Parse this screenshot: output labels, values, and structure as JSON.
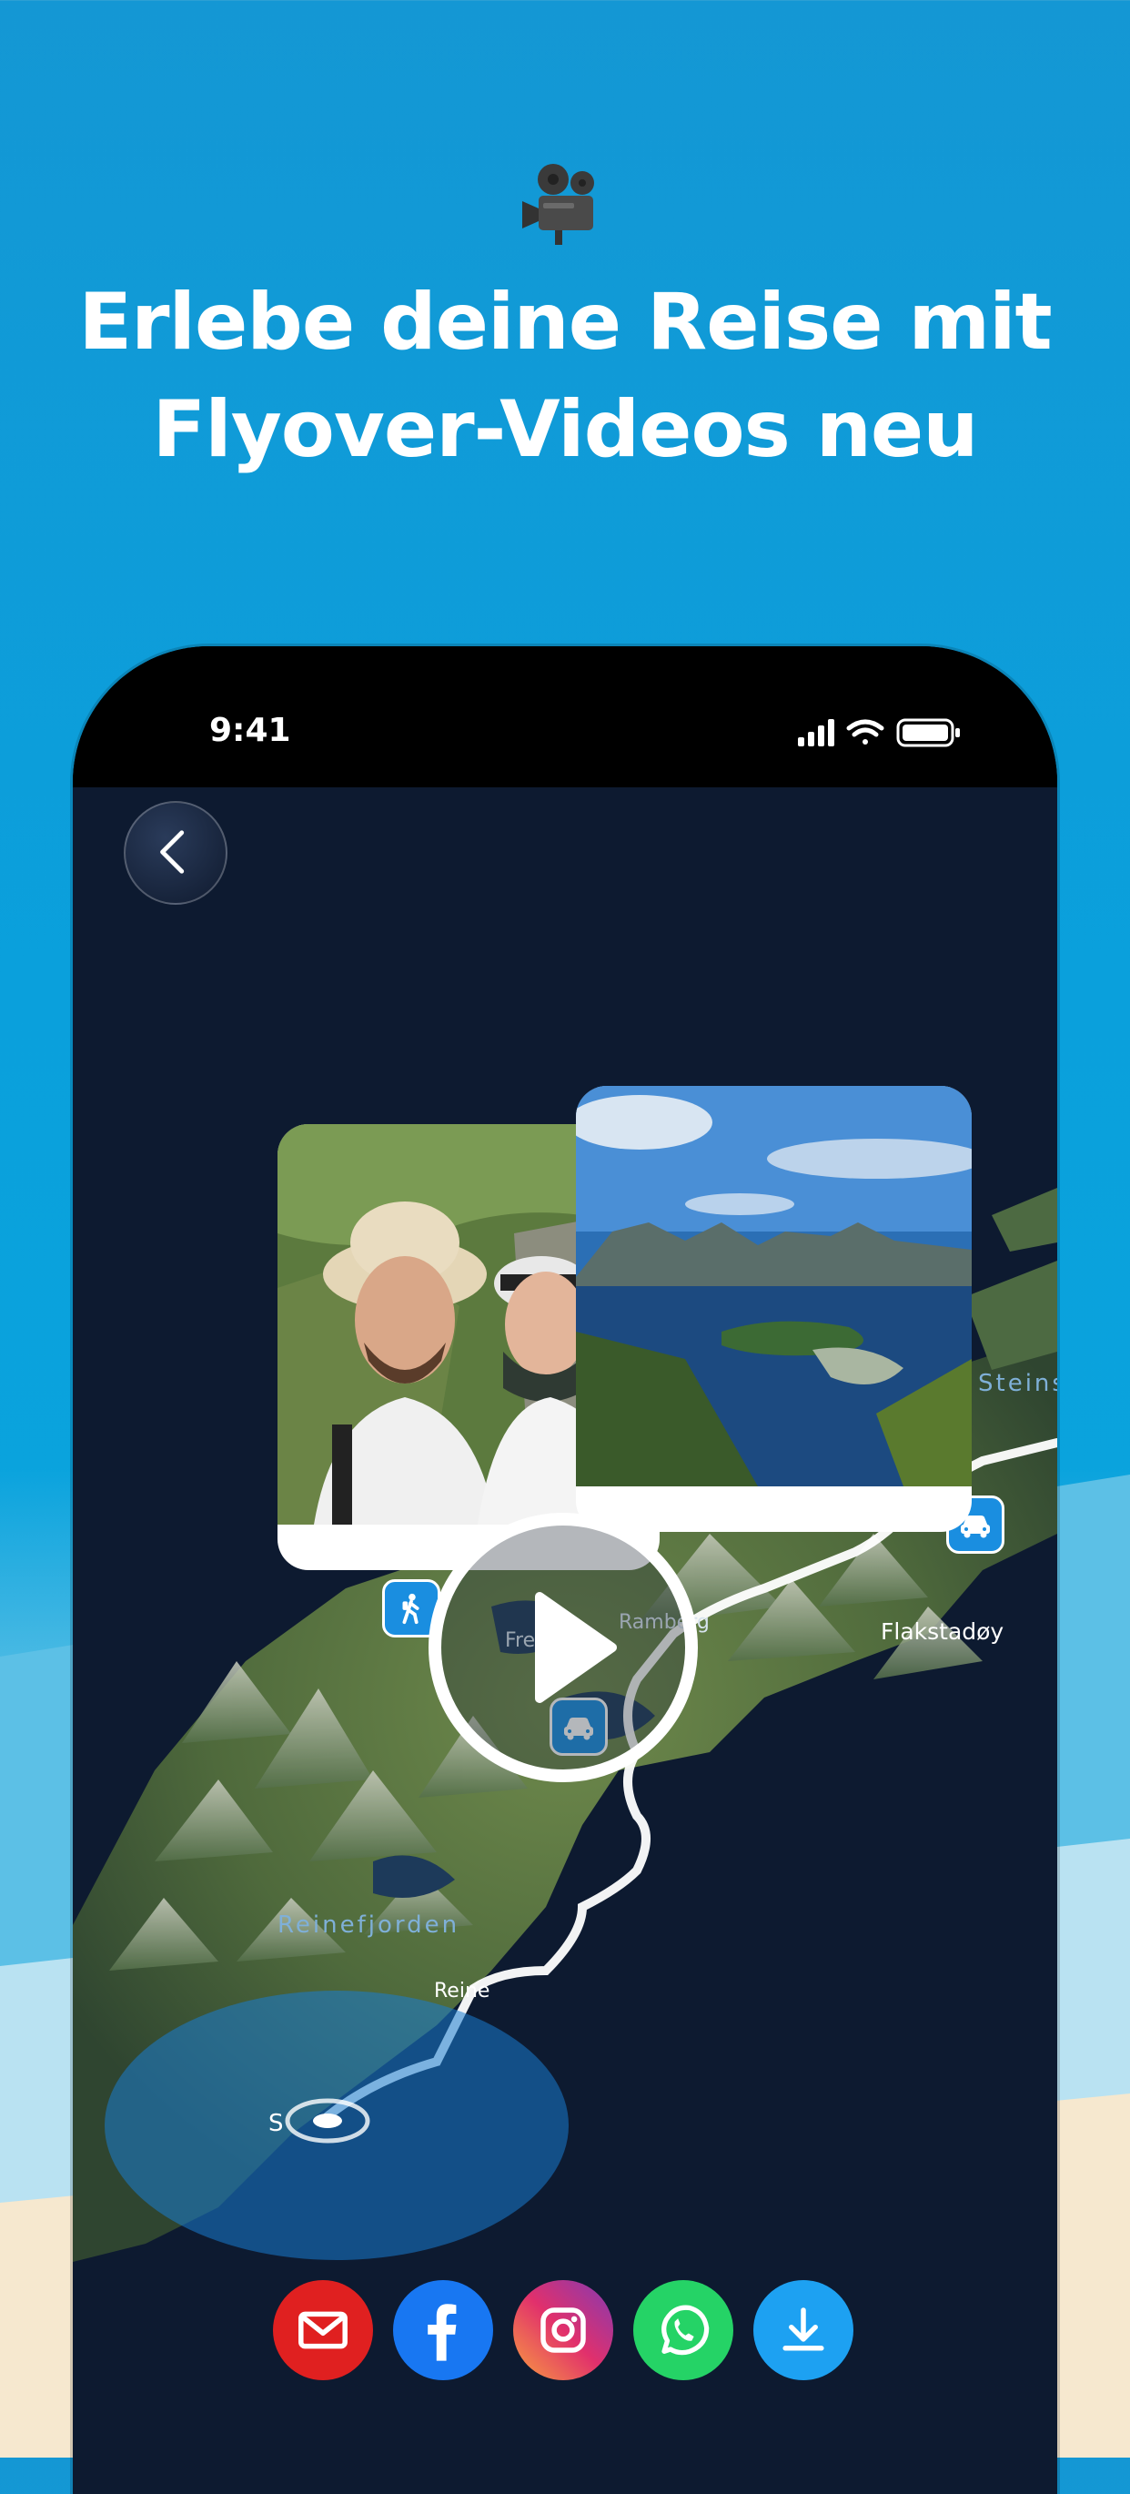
{
  "headline": {
    "line1": "Erlebe deine Reise mit",
    "line2": "Flyover-Videos neu",
    "emoji_icon": "movie-camera-icon"
  },
  "status_bar": {
    "time": "9:41",
    "icons": [
      "signal-icon",
      "wifi-icon",
      "battery-icon"
    ]
  },
  "map": {
    "labels": {
      "steins": "Steins",
      "ramberg": "Ramberg",
      "fre": "Fre",
      "flakstadoy": "Flakstadøy",
      "reinefjorden": "Reinefjorden",
      "reine": "Reine",
      "s": "S"
    },
    "markers": [
      "hiking-icon",
      "car-icon",
      "car-icon"
    ]
  },
  "share_buttons": [
    {
      "name": "mail",
      "color": "#e02020"
    },
    {
      "name": "facebook",
      "color": "#1877f2"
    },
    {
      "name": "instagram",
      "color": "#d62976"
    },
    {
      "name": "whatsapp",
      "color": "#25d366"
    },
    {
      "name": "download",
      "color": "#1da1f2"
    }
  ],
  "colors": {
    "background_top": "#1497d4",
    "map_dark": "#0d1a30",
    "marker_blue": "#1a8ee0"
  }
}
